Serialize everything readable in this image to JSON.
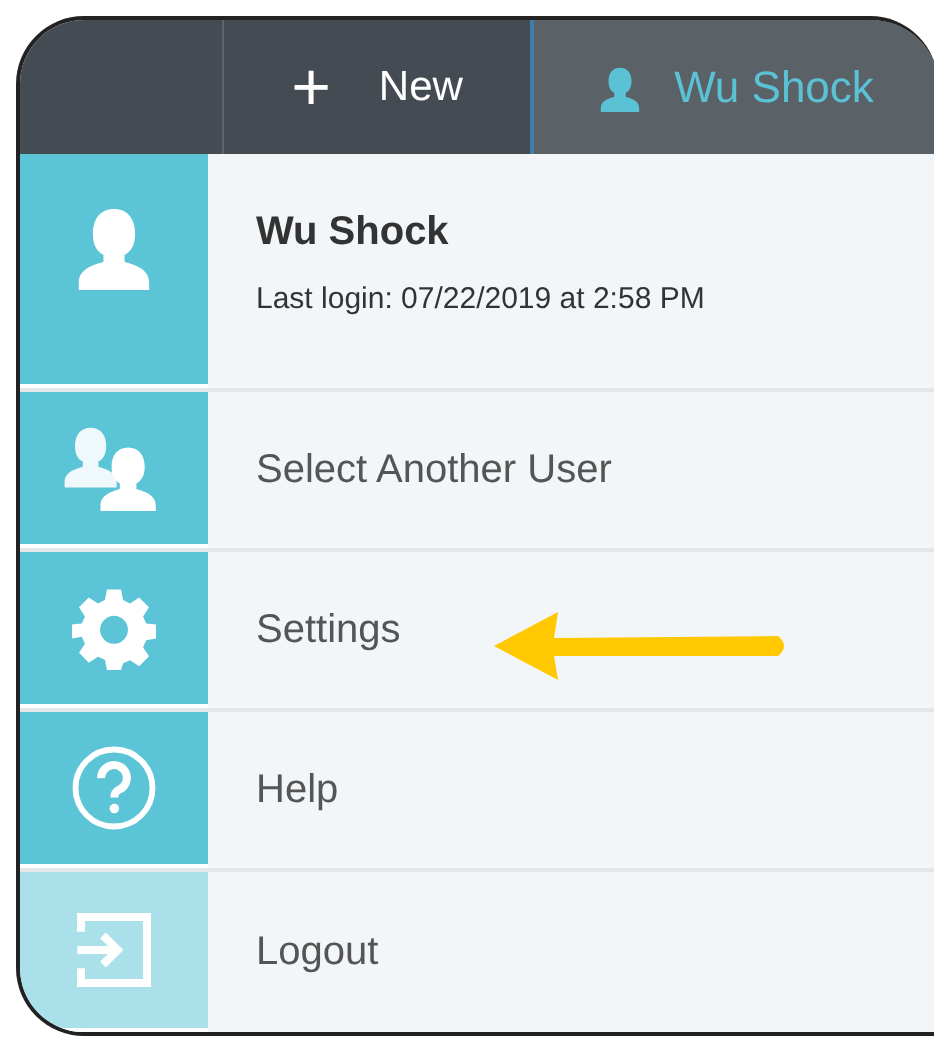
{
  "topbar": {
    "new_button": {
      "icon": "+",
      "label": "New"
    },
    "user_button": {
      "label": "Wu Shock",
      "selected": true
    }
  },
  "profile": {
    "name": "Wu Shock",
    "last_login": "Last login: 07/22/2019 at 2:58 PM"
  },
  "menu": [
    {
      "kind": "users",
      "label": "Select Another User"
    },
    {
      "kind": "settings",
      "label": "Settings"
    },
    {
      "kind": "help",
      "label": "Help"
    },
    {
      "kind": "logout",
      "label": "Logout"
    }
  ]
}
